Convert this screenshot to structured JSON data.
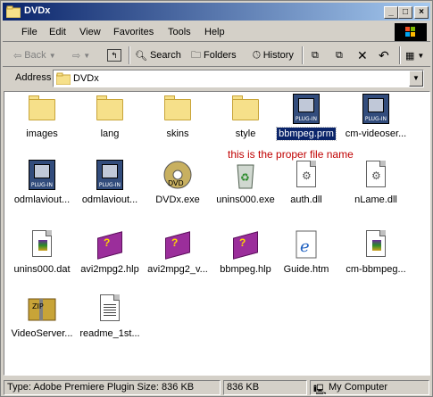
{
  "window": {
    "title": "DVDx"
  },
  "menu": {
    "items": [
      "File",
      "Edit",
      "View",
      "Favorites",
      "Tools",
      "Help"
    ]
  },
  "toolbar": {
    "back": "Back",
    "search": "Search",
    "folders": "Folders",
    "history": "History"
  },
  "address": {
    "label": "Address",
    "value": "DVDx"
  },
  "annotation": "this is the proper file name",
  "files": [
    {
      "name": "images",
      "icon": "folder-icon"
    },
    {
      "name": "lang",
      "icon": "folder-icon"
    },
    {
      "name": "skins",
      "icon": "folder-icon"
    },
    {
      "name": "style",
      "icon": "folder-icon"
    },
    {
      "name": "bbmpeg.prm",
      "icon": "premiere-plugin-icon",
      "selected": true
    },
    {
      "name": "cm-videoser...",
      "icon": "premiere-plugin-icon"
    },
    {
      "name": "odmlaviout...",
      "icon": "premiere-plugin-icon"
    },
    {
      "name": "odmlaviout...",
      "icon": "premiere-plugin-icon"
    },
    {
      "name": "DVDx.exe",
      "icon": "dvd-disc-icon"
    },
    {
      "name": "unins000.exe",
      "icon": "recycle-bin-icon"
    },
    {
      "name": "auth.dll",
      "icon": "dll-gear-icon"
    },
    {
      "name": "nLame.dll",
      "icon": "dll-gear-icon"
    },
    {
      "name": "unins000.dat",
      "icon": "media-file-icon"
    },
    {
      "name": "avi2mpg2.hlp",
      "icon": "help-book-icon"
    },
    {
      "name": "avi2mpg2_v...",
      "icon": "help-book-icon"
    },
    {
      "name": "bbmpeg.hlp",
      "icon": "help-book-icon"
    },
    {
      "name": "Guide.htm",
      "icon": "internet-explorer-icon"
    },
    {
      "name": "cm-bbmpeg...",
      "icon": "media-file-icon"
    },
    {
      "name": "VideoServer...",
      "icon": "zip-archive-icon"
    },
    {
      "name": "readme_1st...",
      "icon": "text-document-icon"
    }
  ],
  "status": {
    "info": "Type: Adobe Premiere Plugin Size: 836 KB",
    "size": "836 KB",
    "zone": "My Computer"
  }
}
